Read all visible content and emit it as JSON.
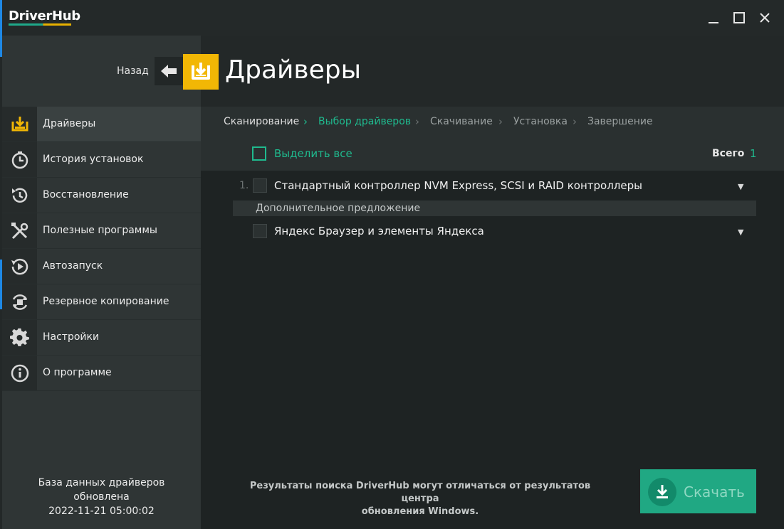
{
  "app": {
    "logo": "DriverHub"
  },
  "header": {
    "back_label": "Назад",
    "title": "Драйверы"
  },
  "sidebar": {
    "items": [
      {
        "label": "Драйверы",
        "icon": "drivers-icon",
        "active": true
      },
      {
        "label": "История установок",
        "icon": "history-icon"
      },
      {
        "label": "Восстановление",
        "icon": "restore-icon"
      },
      {
        "label": "Полезные программы",
        "icon": "tools-icon"
      },
      {
        "label": "Автозапуск",
        "icon": "autostart-icon"
      },
      {
        "label": "Резервное копирование",
        "icon": "backup-icon"
      },
      {
        "label": "Настройки",
        "icon": "gear-icon"
      },
      {
        "label": "О программе",
        "icon": "info-icon"
      }
    ],
    "db_info": {
      "line1": "База данных драйверов",
      "line2": "обновлена",
      "line3": "2022-11-21 05:00:02"
    }
  },
  "breadcrumb": {
    "steps": [
      "Сканирование",
      "Выбор драйверов",
      "Скачивание",
      "Установка",
      "Завершение"
    ],
    "active_index": 1
  },
  "selection": {
    "select_all_label": "Выделить все",
    "total_label": "Всего",
    "total_count": "1"
  },
  "drivers": [
    {
      "number": "1.",
      "name": "Стандартный контроллер NVM Express, SCSI и RAID контроллеры",
      "checked": false
    }
  ],
  "extra": {
    "header": "Дополнительное предложение",
    "items": [
      {
        "name": "Яндекс Браузер и элементы Яндекса",
        "checked": false
      }
    ]
  },
  "footer": {
    "note_line1": "Результаты поиска DriverHub могут отличаться от результатов центра",
    "note_line2": "обновления Windows.",
    "download_label": "Скачать"
  },
  "colors": {
    "accent": "#1fba8e",
    "brand_yellow": "#f2b705",
    "button": "#20a883"
  }
}
